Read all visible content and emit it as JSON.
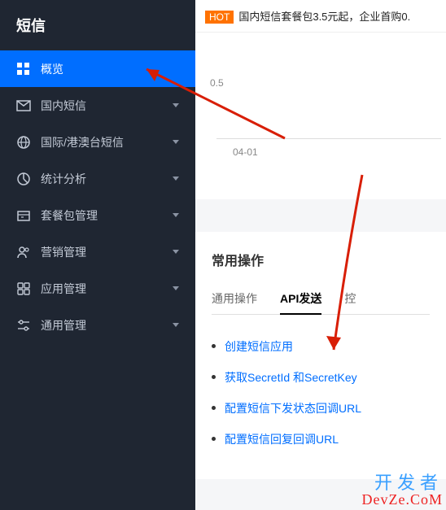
{
  "sidebar": {
    "title": "短信",
    "items": [
      {
        "label": "概览",
        "icon": "overview-icon",
        "expandable": false,
        "active": true
      },
      {
        "label": "国内短信",
        "icon": "mail-icon",
        "expandable": true,
        "active": false
      },
      {
        "label": "国际/港澳台短信",
        "icon": "globe-icon",
        "expandable": true,
        "active": false
      },
      {
        "label": "统计分析",
        "icon": "chart-icon",
        "expandable": true,
        "active": false
      },
      {
        "label": "套餐包管理",
        "icon": "package-icon",
        "expandable": true,
        "active": false
      },
      {
        "label": "营销管理",
        "icon": "people-icon",
        "expandable": true,
        "active": false
      },
      {
        "label": "应用管理",
        "icon": "app-icon",
        "expandable": true,
        "active": false
      },
      {
        "label": "通用管理",
        "icon": "settings-icon",
        "expandable": true,
        "active": false
      }
    ]
  },
  "banner": {
    "badge": "HOT",
    "text": "国内短信套餐包3.5元起，企业首购0."
  },
  "chart_data": {
    "type": "line",
    "title": "",
    "xlabel": "",
    "ylabel": "",
    "ticks_y": [
      "0.5"
    ],
    "ticks_x": [
      "04-01"
    ],
    "ylim": [
      0,
      1
    ],
    "series": []
  },
  "common_ops": {
    "title": "常用操作",
    "tabs": [
      {
        "label": "通用操作",
        "active": false
      },
      {
        "label": "API发送",
        "active": true
      },
      {
        "label": "控",
        "active": false
      }
    ],
    "links": [
      "创建短信应用",
      "获取SecretId 和SecretKey",
      "配置短信下发状态回调URL",
      "配置短信回复回调URL"
    ]
  },
  "watermark": {
    "line1": "开发者",
    "line2": "DevZe.CoM"
  }
}
